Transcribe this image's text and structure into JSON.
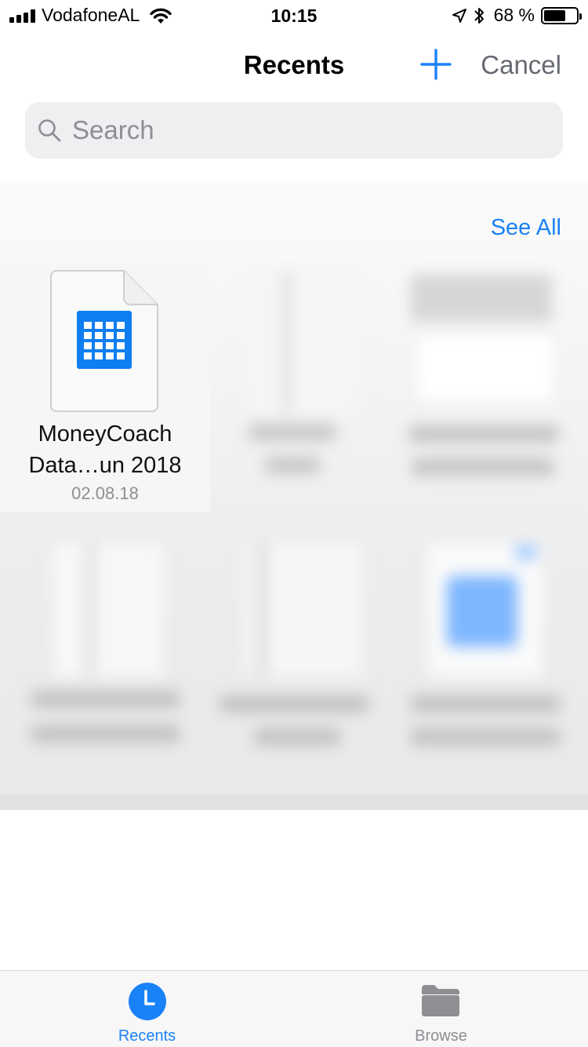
{
  "status_bar": {
    "carrier": "VodafoneAL",
    "time": "10:15",
    "battery_percent_text": "68 %",
    "battery_level": 0.68,
    "icons": [
      "signal-bars-icon",
      "wifi-icon",
      "location-arrow-icon",
      "bluetooth-icon",
      "battery-icon"
    ]
  },
  "nav": {
    "title": "Recents",
    "add_icon": "plus-icon",
    "cancel_label": "Cancel"
  },
  "search": {
    "placeholder": "Search",
    "value": ""
  },
  "recents": {
    "see_all_label": "See All",
    "items": [
      {
        "name_line1": "MoneyCoach",
        "name_line2": "Data…un 2018",
        "date": "02.08.18",
        "icon": "spreadsheet-icon",
        "blurred": false
      }
    ],
    "blurred_items_count": 5
  },
  "tabbar": {
    "tabs": [
      {
        "label": "Recents",
        "icon": "clock-icon",
        "active": true
      },
      {
        "label": "Browse",
        "icon": "folder-icon",
        "active": false
      }
    ]
  },
  "colors": {
    "accent": "#1a82f7",
    "inactive": "#8e8e93",
    "spreadsheet_blue": "#0f7ef0"
  }
}
